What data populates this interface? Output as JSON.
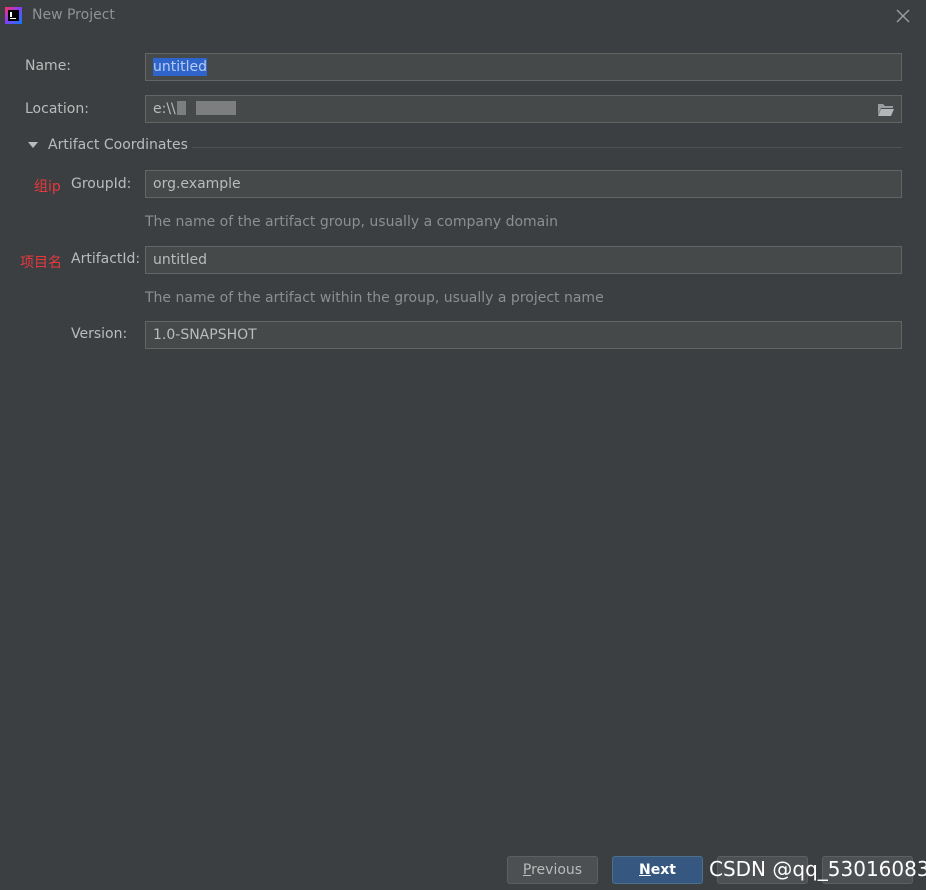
{
  "window": {
    "title": "New Project"
  },
  "form": {
    "name": {
      "label": "Name:",
      "value": "untitled"
    },
    "location": {
      "label": "Location:",
      "value": "e:\\\\"
    },
    "section": {
      "title": "Artifact Coordinates"
    },
    "group_id": {
      "label": "GroupId:",
      "annotation": "组ip",
      "value": "org.example",
      "hint": "The name of the artifact group, usually a company domain"
    },
    "artifact_id": {
      "label": "ArtifactId:",
      "annotation": "项目名",
      "value": "untitled",
      "hint": "The name of the artifact within the group, usually a project name"
    },
    "version": {
      "label": "Version:",
      "value": "1.0-SNAPSHOT"
    }
  },
  "buttons": {
    "previous": {
      "mnemonic": "P",
      "rest": "revious"
    },
    "next": {
      "mnemonic": "N",
      "rest": "ext"
    }
  },
  "watermark": "CSDN @qq_53016083",
  "icons": {
    "app": "intellij-idea-icon",
    "close": "close-icon",
    "folder": "folder-open-icon",
    "toggle": "triangle-down-icon"
  },
  "colors": {
    "background": "#3c3f41",
    "field": "#45494a",
    "selection": "#2f65ca",
    "primary_button": "#365880",
    "annotation": "#e8383d"
  }
}
